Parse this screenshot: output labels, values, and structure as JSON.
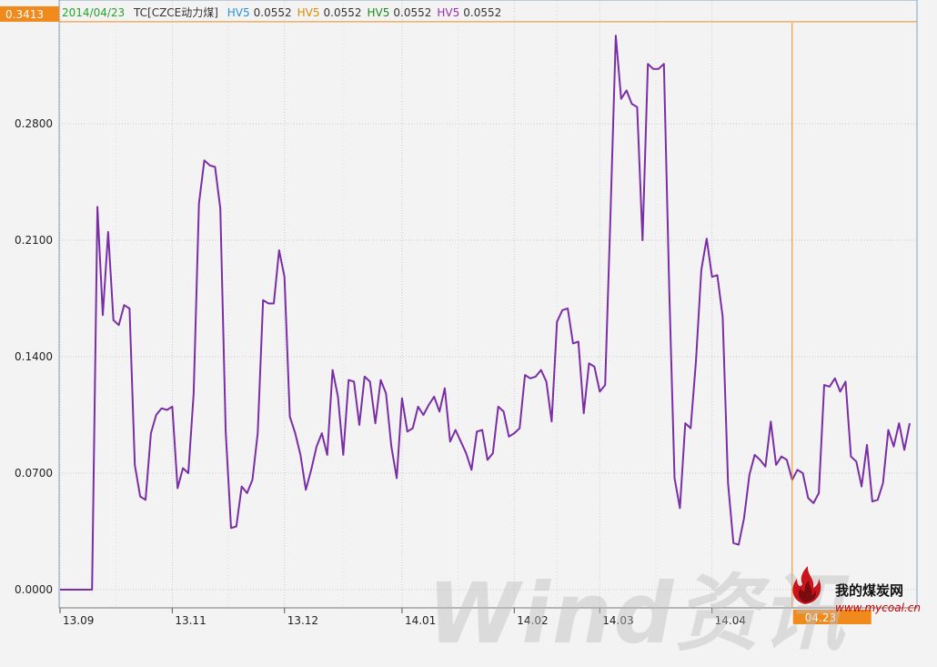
{
  "legend": {
    "date": "2014/04/23",
    "instrument": "TC[CZCE动力煤]",
    "entries": [
      {
        "label": "HV5",
        "value": "0.0552",
        "color": "#2a8fd6"
      },
      {
        "label": "HV5",
        "value": "0.0552",
        "color": "#e08a00"
      },
      {
        "label": "HV5",
        "value": "0.0552",
        "color": "#1a8a1a"
      },
      {
        "label": "HV5",
        "value": "0.0552",
        "color": "#9b2bb5"
      }
    ]
  },
  "crosshair": {
    "y_value_label": "0.3413",
    "x_date_label": "04.23",
    "color": "#f08a1c"
  },
  "watermark": "Wind资讯",
  "brand": {
    "name": "我的煤炭网",
    "url": "www.mycoal.cn"
  },
  "chart_data": {
    "type": "line",
    "series": [
      {
        "color": "#7a2ea6",
        "values": [
          0.0,
          0.0,
          0.0,
          0.0,
          0.0,
          0.0,
          0.0,
          0.23,
          0.165,
          0.215,
          0.162,
          0.159,
          0.171,
          0.169,
          0.075,
          0.056,
          0.054,
          0.094,
          0.105,
          0.109,
          0.108,
          0.11,
          0.061,
          0.073,
          0.07,
          0.118,
          0.232,
          0.258,
          0.255,
          0.254,
          0.229,
          0.095,
          0.037,
          0.038,
          0.062,
          0.058,
          0.066,
          0.094,
          0.174,
          0.172,
          0.172,
          0.204,
          0.188,
          0.104,
          0.094,
          0.081,
          0.06,
          0.072,
          0.086,
          0.094,
          0.081,
          0.132,
          0.116,
          0.081,
          0.126,
          0.125,
          0.099,
          0.128,
          0.125,
          0.1,
          0.126,
          0.118,
          0.086,
          0.067,
          0.115,
          0.095,
          0.097,
          0.11,
          0.105,
          0.111,
          0.116,
          0.107,
          0.121,
          0.089,
          0.096,
          0.089,
          0.082,
          0.072,
          0.095,
          0.096,
          0.078,
          0.082,
          0.11,
          0.107,
          0.092,
          0.094,
          0.097,
          0.129,
          0.127,
          0.128,
          0.132,
          0.125,
          0.101,
          0.161,
          0.168,
          0.169,
          0.148,
          0.149,
          0.106,
          0.136,
          0.134,
          0.119,
          0.123,
          0.224,
          0.333,
          0.295,
          0.3,
          0.292,
          0.29,
          0.21,
          0.316,
          0.313,
          0.313,
          0.316,
          0.18,
          0.067,
          0.049,
          0.1,
          0.097,
          0.137,
          0.192,
          0.211,
          0.188,
          0.189,
          0.164,
          0.064,
          0.028,
          0.027,
          0.043,
          0.069,
          0.081,
          0.078,
          0.074,
          0.101,
          0.075,
          0.08,
          0.078,
          0.066,
          0.072,
          0.07,
          0.055,
          0.052,
          0.058,
          0.123,
          0.122,
          0.127,
          0.119,
          0.125,
          0.08,
          0.077,
          0.062,
          0.087,
          0.053,
          0.054,
          0.064,
          0.096,
          0.086,
          0.1,
          0.084,
          0.1
        ]
      }
    ],
    "y_ticks": [
      "0.0000",
      "0.0700",
      "0.1400",
      "0.2100",
      "0.2800"
    ],
    "ylim": [
      0,
      0.35
    ],
    "x_ticks": [
      {
        "label": "13.09",
        "index": 0
      },
      {
        "label": "13.11",
        "index": 21
      },
      {
        "label": "13.12",
        "index": 42
      },
      {
        "label": "14.01",
        "index": 64
      },
      {
        "label": "14.02",
        "index": 85
      },
      {
        "label": "14.03",
        "index": 101
      },
      {
        "label": "14.04",
        "index": 122
      }
    ],
    "crosshair_index": 137,
    "crosshair_value": 0.3413,
    "grid": true
  }
}
